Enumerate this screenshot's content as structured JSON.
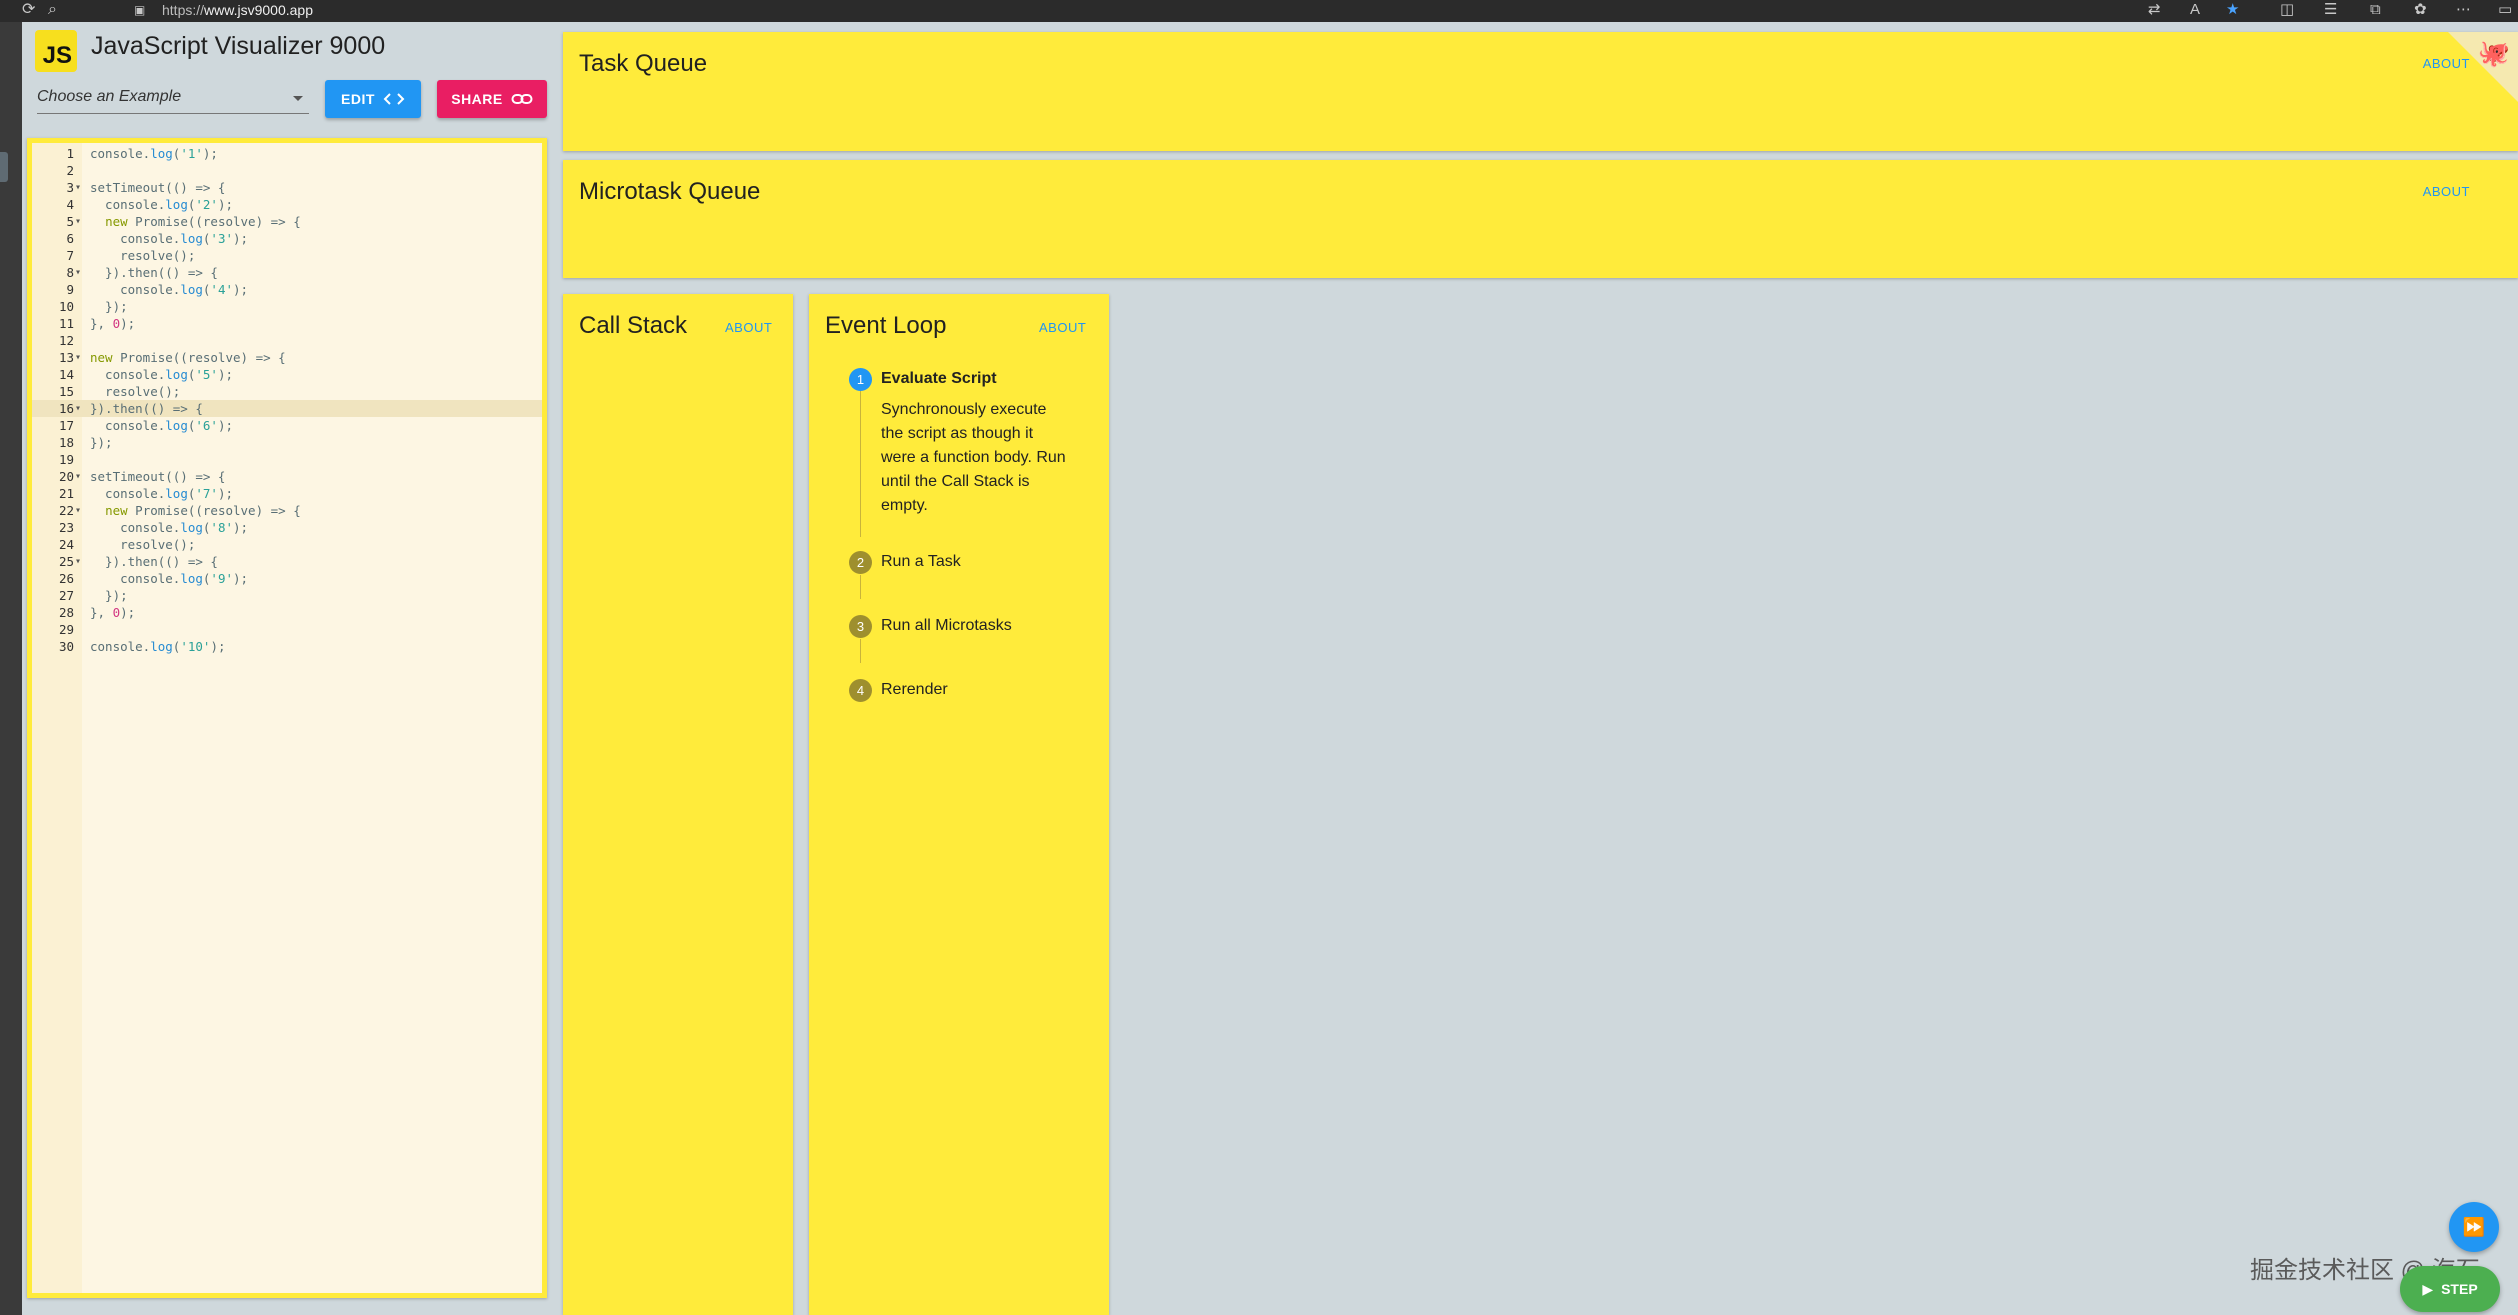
{
  "browser": {
    "url_prefix": "https://",
    "url_host": "www.jsv9000.app"
  },
  "header": {
    "logo_text": "JS",
    "title": "JavaScript Visualizer 9000",
    "example_placeholder": "Choose an Example",
    "edit_label": "EDIT",
    "share_label": "SHARE"
  },
  "editor": {
    "active_line": 16,
    "lines": [
      {
        "n": "1",
        "fold": "",
        "tokens": [
          [
            "plain",
            "console."
          ],
          [
            "fn",
            "log"
          ],
          [
            "plain",
            "("
          ],
          [
            "str",
            "'1'"
          ],
          [
            "plain",
            ");"
          ]
        ]
      },
      {
        "n": "2",
        "fold": "",
        "tokens": []
      },
      {
        "n": "3",
        "fold": "▾",
        "tokens": [
          [
            "plain",
            "setTimeout(() => {"
          ]
        ]
      },
      {
        "n": "4",
        "fold": "",
        "tokens": [
          [
            "plain",
            "  console."
          ],
          [
            "fn",
            "log"
          ],
          [
            "plain",
            "("
          ],
          [
            "str",
            "'2'"
          ],
          [
            "plain",
            ");"
          ]
        ]
      },
      {
        "n": "5",
        "fold": "▾",
        "tokens": [
          [
            "plain",
            "  "
          ],
          [
            "kw",
            "new"
          ],
          [
            "plain",
            " Promise((resolve) => {"
          ]
        ]
      },
      {
        "n": "6",
        "fold": "",
        "tokens": [
          [
            "plain",
            "    console."
          ],
          [
            "fn",
            "log"
          ],
          [
            "plain",
            "("
          ],
          [
            "str",
            "'3'"
          ],
          [
            "plain",
            ");"
          ]
        ]
      },
      {
        "n": "7",
        "fold": "",
        "tokens": [
          [
            "plain",
            "    resolve();"
          ]
        ]
      },
      {
        "n": "8",
        "fold": "▾",
        "tokens": [
          [
            "plain",
            "  }).then(() => {"
          ]
        ]
      },
      {
        "n": "9",
        "fold": "",
        "tokens": [
          [
            "plain",
            "    console."
          ],
          [
            "fn",
            "log"
          ],
          [
            "plain",
            "("
          ],
          [
            "str",
            "'4'"
          ],
          [
            "plain",
            ");"
          ]
        ]
      },
      {
        "n": "10",
        "fold": "",
        "tokens": [
          [
            "plain",
            "  });"
          ]
        ]
      },
      {
        "n": "11",
        "fold": "",
        "tokens": [
          [
            "plain",
            "}, "
          ],
          [
            "num",
            "0"
          ],
          [
            "plain",
            ");"
          ]
        ]
      },
      {
        "n": "12",
        "fold": "",
        "tokens": []
      },
      {
        "n": "13",
        "fold": "▾",
        "tokens": [
          [
            "kw",
            "new"
          ],
          [
            "plain",
            " Promise((resolve) => {"
          ]
        ]
      },
      {
        "n": "14",
        "fold": "",
        "tokens": [
          [
            "plain",
            "  console."
          ],
          [
            "fn",
            "log"
          ],
          [
            "plain",
            "("
          ],
          [
            "str",
            "'5'"
          ],
          [
            "plain",
            ");"
          ]
        ]
      },
      {
        "n": "15",
        "fold": "",
        "tokens": [
          [
            "plain",
            "  resolve();"
          ]
        ]
      },
      {
        "n": "16",
        "fold": "▾",
        "tokens": [
          [
            "plain",
            "}).then(() => {"
          ]
        ]
      },
      {
        "n": "17",
        "fold": "",
        "tokens": [
          [
            "plain",
            "  console."
          ],
          [
            "fn",
            "log"
          ],
          [
            "plain",
            "("
          ],
          [
            "str",
            "'6'"
          ],
          [
            "plain",
            ");"
          ]
        ]
      },
      {
        "n": "18",
        "fold": "",
        "tokens": [
          [
            "plain",
            "});"
          ]
        ]
      },
      {
        "n": "19",
        "fold": "",
        "tokens": []
      },
      {
        "n": "20",
        "fold": "▾",
        "tokens": [
          [
            "plain",
            "setTimeout(() => {"
          ]
        ]
      },
      {
        "n": "21",
        "fold": "",
        "tokens": [
          [
            "plain",
            "  console."
          ],
          [
            "fn",
            "log"
          ],
          [
            "plain",
            "("
          ],
          [
            "str",
            "'7'"
          ],
          [
            "plain",
            ");"
          ]
        ]
      },
      {
        "n": "22",
        "fold": "▾",
        "tokens": [
          [
            "plain",
            "  "
          ],
          [
            "kw",
            "new"
          ],
          [
            "plain",
            " Promise((resolve) => {"
          ]
        ]
      },
      {
        "n": "23",
        "fold": "",
        "tokens": [
          [
            "plain",
            "    console."
          ],
          [
            "fn",
            "log"
          ],
          [
            "plain",
            "("
          ],
          [
            "str",
            "'8'"
          ],
          [
            "plain",
            ");"
          ]
        ]
      },
      {
        "n": "24",
        "fold": "",
        "tokens": [
          [
            "plain",
            "    resolve();"
          ]
        ]
      },
      {
        "n": "25",
        "fold": "▾",
        "tokens": [
          [
            "plain",
            "  }).then(() => {"
          ]
        ]
      },
      {
        "n": "26",
        "fold": "",
        "tokens": [
          [
            "plain",
            "    console."
          ],
          [
            "fn",
            "log"
          ],
          [
            "plain",
            "("
          ],
          [
            "str",
            "'9'"
          ],
          [
            "plain",
            ");"
          ]
        ]
      },
      {
        "n": "27",
        "fold": "",
        "tokens": [
          [
            "plain",
            "  });"
          ]
        ]
      },
      {
        "n": "28",
        "fold": "",
        "tokens": [
          [
            "plain",
            "}, "
          ],
          [
            "num",
            "0"
          ],
          [
            "plain",
            ");"
          ]
        ]
      },
      {
        "n": "29",
        "fold": "",
        "tokens": []
      },
      {
        "n": "30",
        "fold": "",
        "tokens": [
          [
            "plain",
            "console."
          ],
          [
            "fn",
            "log"
          ],
          [
            "plain",
            "("
          ],
          [
            "str",
            "'10'"
          ],
          [
            "plain",
            ");"
          ]
        ]
      }
    ]
  },
  "panels": {
    "task_queue": {
      "title": "Task Queue",
      "about": "ABOUT"
    },
    "microtask_queue": {
      "title": "Microtask Queue",
      "about": "ABOUT"
    },
    "call_stack": {
      "title": "Call Stack",
      "about": "ABOUT"
    },
    "event_loop": {
      "title": "Event Loop",
      "about": "ABOUT",
      "steps": [
        {
          "num": "1",
          "label": "Evaluate Script",
          "active": true
        },
        {
          "num": "2",
          "label": "Run a Task",
          "active": false
        },
        {
          "num": "3",
          "label": "Run all Microtasks",
          "active": false
        },
        {
          "num": "4",
          "label": "Rerender",
          "active": false
        }
      ],
      "active_description": "Synchronously execute the script as though it were a function body. Run until the Call Stack is empty."
    }
  },
  "controls": {
    "step_label": "STEP"
  },
  "watermark": "掘金技术社区 @ 海石",
  "colors": {
    "panel": "#ffeb3b",
    "background": "#cfd8dc",
    "accent_blue": "#2196f3",
    "accent_pink": "#e91e63",
    "accent_green": "#4caf50"
  }
}
